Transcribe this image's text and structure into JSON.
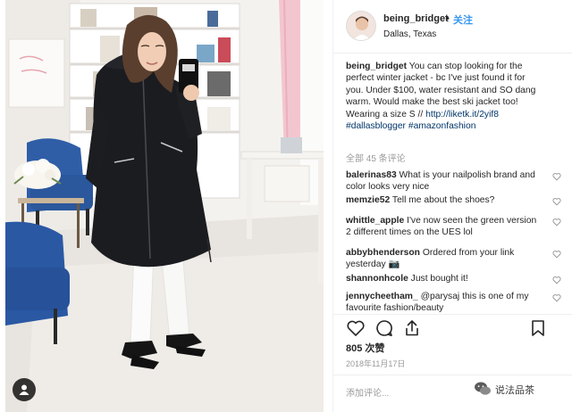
{
  "post": {
    "username": "being_bridget",
    "dot": "•",
    "follow_label": "关注",
    "location": "Dallas, Texas"
  },
  "caption": {
    "username": "being_bridget",
    "text": "You can stop looking for the perfect winter jacket - bc I've just found it for you. Under $100, water resistant and SO dang warm. Would make the best ski jacket too! Wearing a size S //",
    "link": "http://liketk.it/2yif8",
    "hashtag_1": "#dallasblogger",
    "hashtag_2": "#amazonfashion"
  },
  "view_all_comments": "全部 45 条评论",
  "comments": [
    {
      "username": "balerinas83",
      "text": "What is your nailpolish brand and color looks very nice"
    },
    {
      "username": "memzie52",
      "text": "Tell me about the shoes?"
    },
    {
      "username": "whittle_apple",
      "text": "I've now seen the green version 2 different times on the UES lol"
    },
    {
      "username": "abbybhenderson",
      "text": "Ordered from your link yesterday 📷"
    },
    {
      "username": "shannonhcole",
      "text": "Just bought it!"
    },
    {
      "username": "jennycheetham_",
      "text": "@parysaj this is one of my favourite fashion/beauty"
    }
  ],
  "likes": "805 次赞",
  "date": "2018年11月17日",
  "add_comment_placeholder": "添加评论...",
  "watermark": "说法品茶",
  "icons": {
    "like": "heart-icon",
    "comment": "comment-bubble-icon",
    "share": "share-icon",
    "save": "bookmark-icon",
    "user_tag": "user-tag-icon",
    "comment_like": "small-heart-icon"
  }
}
